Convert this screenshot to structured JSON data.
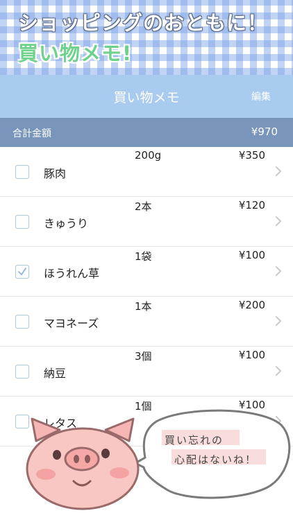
{
  "promo": {
    "line1": "ショッピングのおともに！",
    "line2": "買い物メモ!"
  },
  "nav": {
    "title": "買い物メモ",
    "edit_label": "編集"
  },
  "total": {
    "label": "合計金額",
    "value": "¥970"
  },
  "items": [
    {
      "name": "豚肉",
      "qty": "200g",
      "price": "¥350",
      "checked": false
    },
    {
      "name": "きゅうり",
      "qty": "2本",
      "price": "¥120",
      "checked": false
    },
    {
      "name": "ほうれん草",
      "qty": "1袋",
      "price": "¥100",
      "checked": true
    },
    {
      "name": "マヨネーズ",
      "qty": "1本",
      "price": "¥200",
      "checked": false
    },
    {
      "name": "納豆",
      "qty": "3個",
      "price": "¥100",
      "checked": false
    },
    {
      "name": "レタス",
      "qty": "1個",
      "price": "¥100",
      "checked": false
    }
  ],
  "speech": {
    "line1": "買い忘れの",
    "line2": "心配はないね！"
  },
  "icons": {
    "checkbox": "checkbox-icon",
    "check": "checkmark-icon",
    "chevron": "chevron-right-icon",
    "mascot": "pig-mascot-icon"
  },
  "colors": {
    "nav_bg": "#a9cbef",
    "total_bg": "#7a95bb",
    "checkbox_border": "#a8c4e6",
    "promo_green": "#6fd28c"
  }
}
